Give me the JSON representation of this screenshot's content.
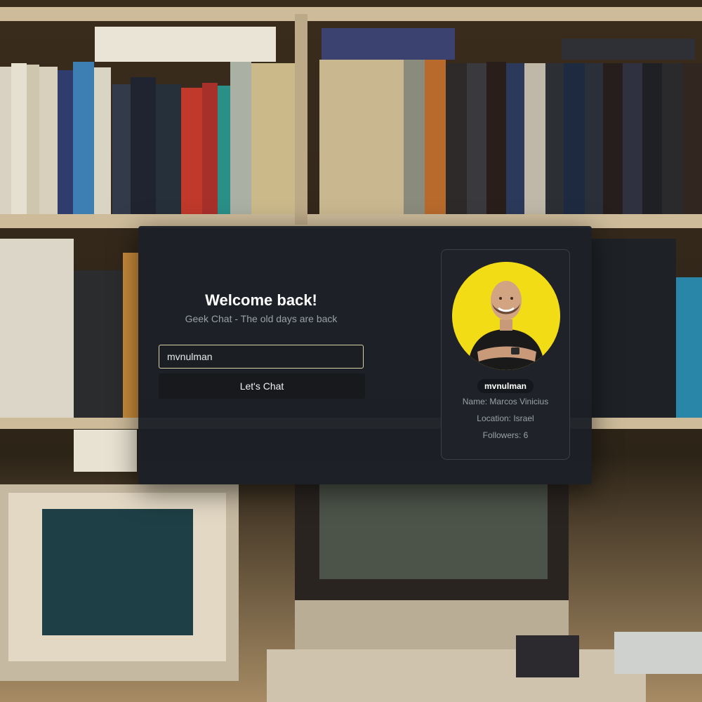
{
  "login": {
    "title": "Welcome back!",
    "subtitle": "Geek Chat - The old days are back",
    "username_value": "mvnulman",
    "button_label": "Let's Chat"
  },
  "profile": {
    "handle": "mvnulman",
    "name_line": "Name: Marcos Vinicius",
    "location_line": "Location: Israel",
    "followers_line": "Followers: 6"
  },
  "colors": {
    "card": "#1c2026",
    "avatar_bg": "#f2dc16",
    "input_border": "#d8cfa4"
  }
}
